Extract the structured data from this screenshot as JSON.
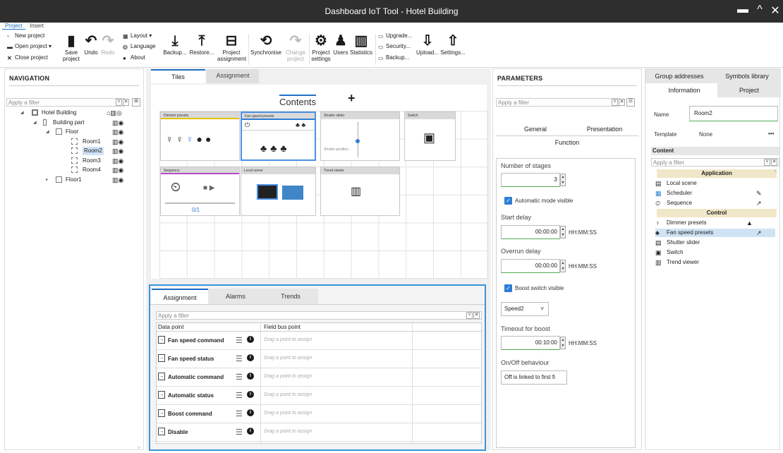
{
  "window": {
    "title": "Dashboard IoT Tool - Hotel Building",
    "minimize": "▬",
    "maximize": "^",
    "close": "✕"
  },
  "ribbon": {
    "tabs": [
      {
        "label": "Project"
      },
      {
        "label": "Insert"
      }
    ],
    "file_group": {
      "new_project": "New project",
      "open_project": "Open project ▾",
      "close_project": "Close project"
    },
    "buttons": {
      "save": "Save project",
      "undo": "Undo",
      "redo": "Redo",
      "layout": "Layout ▾",
      "language": "Language",
      "about": "About",
      "backup": "Backup...",
      "restore": "Restore...",
      "project_assignment": "Project assignment",
      "synchronise": "Synchronise",
      "change_project": "Change project",
      "project_settings": "Project settings",
      "users": "Users",
      "statistics": "Statistics",
      "upgrade": "Upgrade...",
      "security": "Security...",
      "backup2": "Backup...",
      "upload": "Upload...",
      "settings": "Settings..."
    }
  },
  "navigation": {
    "title": "NAVIGATION",
    "filter_placeholder": "Apply a filter",
    "tree": [
      {
        "label": "Hotel Building"
      },
      {
        "label": "Building part"
      },
      {
        "label": "Floor"
      },
      {
        "label": "Room1"
      },
      {
        "label": "Room2"
      },
      {
        "label": "Room3"
      },
      {
        "label": "Room4"
      },
      {
        "label": "Floor1"
      }
    ]
  },
  "center": {
    "tabs": [
      {
        "label": "Tiles"
      },
      {
        "label": "Assignment"
      }
    ],
    "contents_label": "Contents",
    "add_label": "+",
    "tiles": [
      {
        "title": "Dimmer presets"
      },
      {
        "title": "Fan speed presets"
      },
      {
        "title": "Shutter slider"
      },
      {
        "title": "Switch"
      },
      {
        "title": "Sequence"
      },
      {
        "title": "Local scene"
      },
      {
        "title": "Trend viewer"
      }
    ],
    "sequence_counter": "0/1",
    "shutter_text": "Shutter position"
  },
  "assignment": {
    "tabs": [
      {
        "label": "Assignment"
      },
      {
        "label": "Alarms"
      },
      {
        "label": "Trends"
      }
    ],
    "filter_placeholder": "Apply a filter",
    "columns": [
      "Data point",
      "Field bus point"
    ],
    "drag_hint": "Drag a point to assign",
    "rows": [
      {
        "name": "Fan speed command"
      },
      {
        "name": "Fan speed status"
      },
      {
        "name": "Automatic command"
      },
      {
        "name": "Automatic status"
      },
      {
        "name": "Boost command"
      },
      {
        "name": "Disable"
      }
    ]
  },
  "parameters": {
    "title": "PARAMETERS",
    "filter_placeholder": "Apply a filter",
    "tabs": [
      {
        "label": "General"
      },
      {
        "label": "Presentation"
      }
    ],
    "section": "Function",
    "number_of_stages_label": "Number of stages",
    "number_of_stages": "3",
    "automatic_mode_label": "Automatic mode visible",
    "start_delay_label": "Start delay",
    "start_delay": "00:00:00",
    "overrun_delay_label": "Overrun delay",
    "overrun_delay": "00:00:00",
    "time_unit": "HH:MM:SS",
    "boost_switch_label": "Boost switch visible",
    "speed_select": "Speed2",
    "timeout_boost_label": "Timeout for boost",
    "timeout_boost": "00:10:00",
    "onoff_label": "On/Off behaviour",
    "onoff_value": "Off is linked to first fi"
  },
  "right": {
    "tabs_top": [
      {
        "label": "Group addresses"
      },
      {
        "label": "Symbols library"
      }
    ],
    "tabs_sub": [
      {
        "label": "Information"
      },
      {
        "label": "Project"
      }
    ],
    "name_label": "Name",
    "name_value": "Room2",
    "template_label": "Template",
    "template_value": "None",
    "more": "•••",
    "content_label": "Content",
    "filter_placeholder": "Apply a filter",
    "groups": [
      {
        "label": "Application",
        "items": [
          {
            "label": "Local scene"
          },
          {
            "label": "Scheduler"
          },
          {
            "label": "Sequence"
          }
        ]
      },
      {
        "label": "Control",
        "items": [
          {
            "label": "Dimmer presets"
          },
          {
            "label": "Fan speed presets"
          },
          {
            "label": "Shutter slider"
          },
          {
            "label": "Switch"
          },
          {
            "label": "Trend viewer"
          }
        ]
      }
    ]
  },
  "colors": {
    "accent": "#1f6fc5",
    "selection": "#cfe3f5",
    "titlebar": "#2e2e2e",
    "assign_border": "#3b94d9",
    "group_bg": "#efe7c8"
  }
}
